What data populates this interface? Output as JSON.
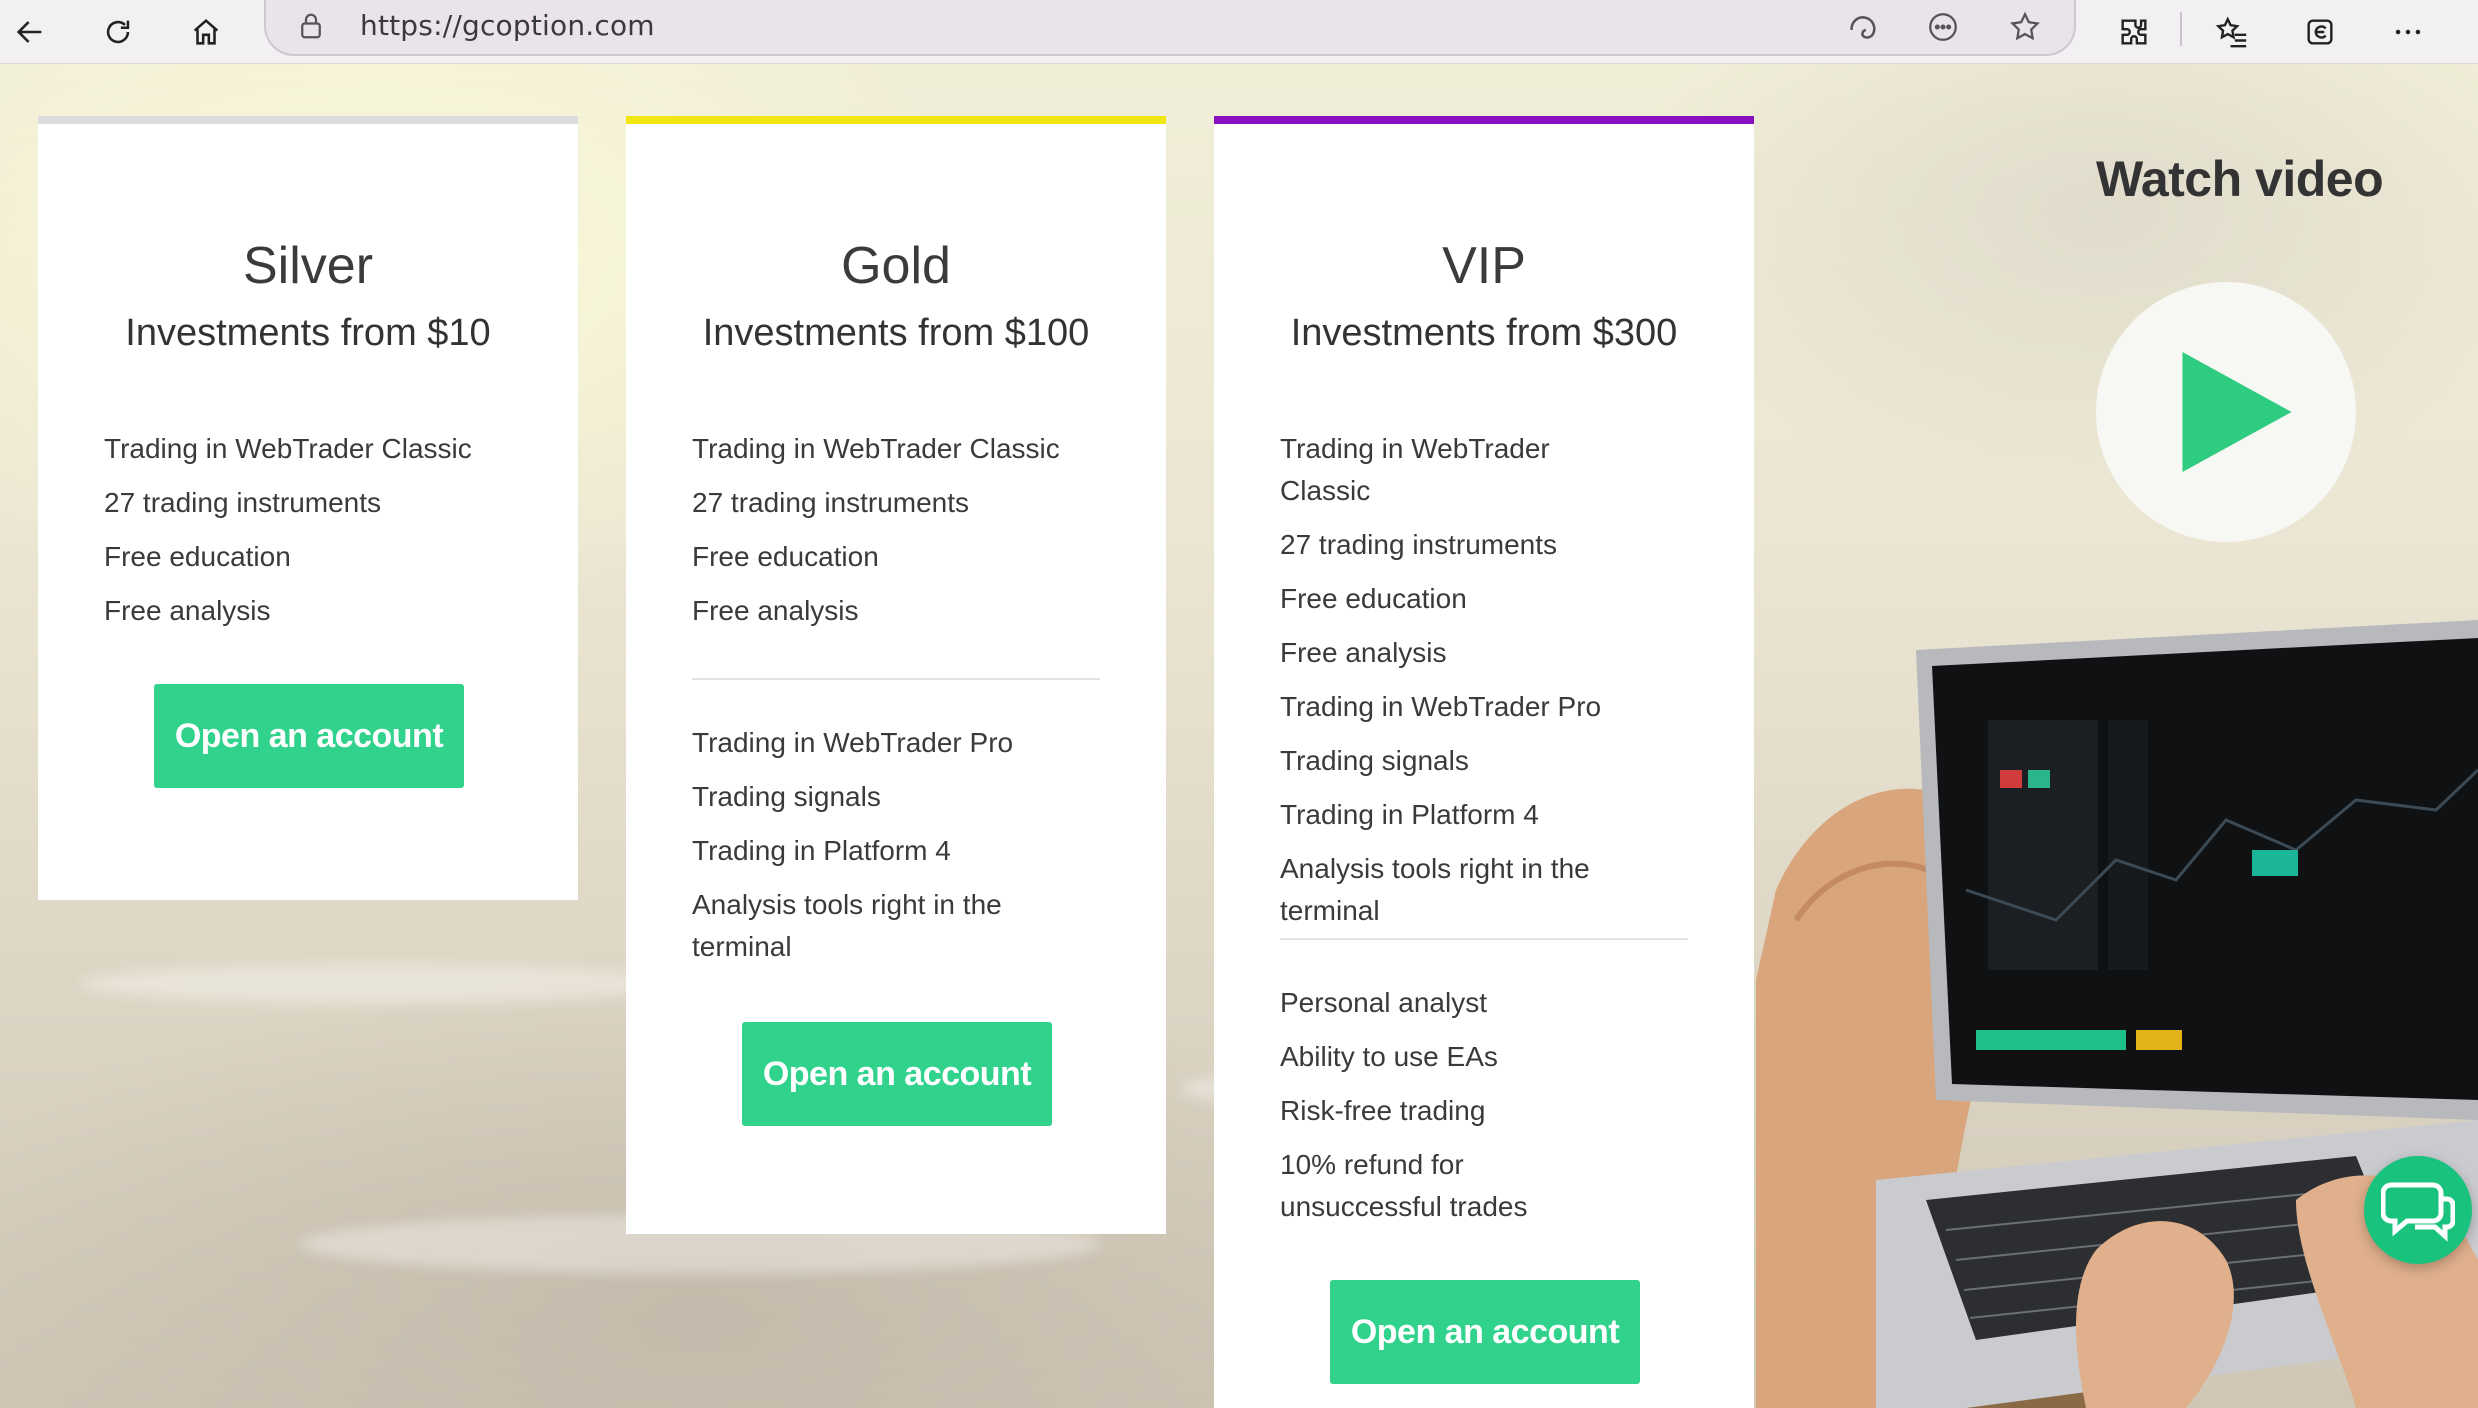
{
  "browser": {
    "url": "https://gcoption.com",
    "icons": [
      "back-arrow-icon",
      "refresh-icon",
      "home-icon",
      "lock-icon",
      "edge-sidebar-icon",
      "reading-mode-icon",
      "favorite-star-icon",
      "extensions-icon",
      "favorites-list-icon",
      "collections-icon",
      "more-menu-icon"
    ]
  },
  "colors": {
    "accent_green": "#30d28c",
    "silver_line": "#dcdcdc",
    "gold_line": "#f2e614",
    "vip_line": "#8a0fc0"
  },
  "plans": [
    {
      "title": "Silver",
      "subtitle": "Investments from $10",
      "features": [
        "Trading in WebTrader Classic",
        "27 trading instruments",
        "Free education",
        "Free analysis"
      ],
      "button": "Open an account"
    },
    {
      "title": "Gold",
      "subtitle": "Investments from $100",
      "features": [
        "Trading in WebTrader Classic",
        "27 trading instruments",
        "Free education",
        "Free analysis"
      ],
      "extra_features": [
        "Trading in WebTrader Pro",
        "Trading signals",
        "Trading in Platform 4",
        "Analysis tools right in the terminal"
      ],
      "button": "Open an account"
    },
    {
      "title": "VIP",
      "subtitle": "Investments from $300",
      "features": [
        "Trading in WebTrader Classic",
        "27 trading instruments",
        "Free education",
        "Free analysis",
        "Trading in WebTrader Pro",
        "Trading signals",
        "Trading in Platform 4",
        "Analysis tools right in the terminal"
      ],
      "extra_features": [
        "Personal analyst",
        "Ability to use EAs",
        "Risk-free trading",
        "10% refund for unsuccessful trades"
      ],
      "button": "Open an account"
    }
  ],
  "video": {
    "title": "Watch video"
  }
}
